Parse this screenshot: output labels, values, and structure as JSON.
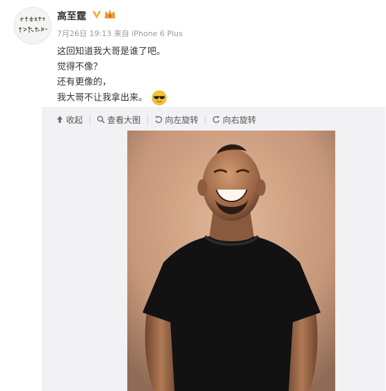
{
  "post": {
    "username": "高至霆",
    "meta": "7月26日 19:13 来自 iPhone 6 Plus",
    "lines": [
      "这回知道我大哥是谁了吧。",
      "觉得不像？",
      "还有更像的，",
      "我大哥不让我拿出来。"
    ]
  },
  "toolbar": {
    "collapse": "收起",
    "view_large": "查看大图",
    "rotate_left": "向左旋转",
    "rotate_right": "向右旋转"
  },
  "icons": [
    "avatar",
    "verified-icon",
    "crown-icon",
    "sunglasses-emoji",
    "collapse-icon",
    "zoom-icon",
    "rotate-left-icon",
    "rotate-right-icon"
  ],
  "colors": {
    "verified": "#f5a623",
    "photo_bg": "#c79b7c"
  }
}
